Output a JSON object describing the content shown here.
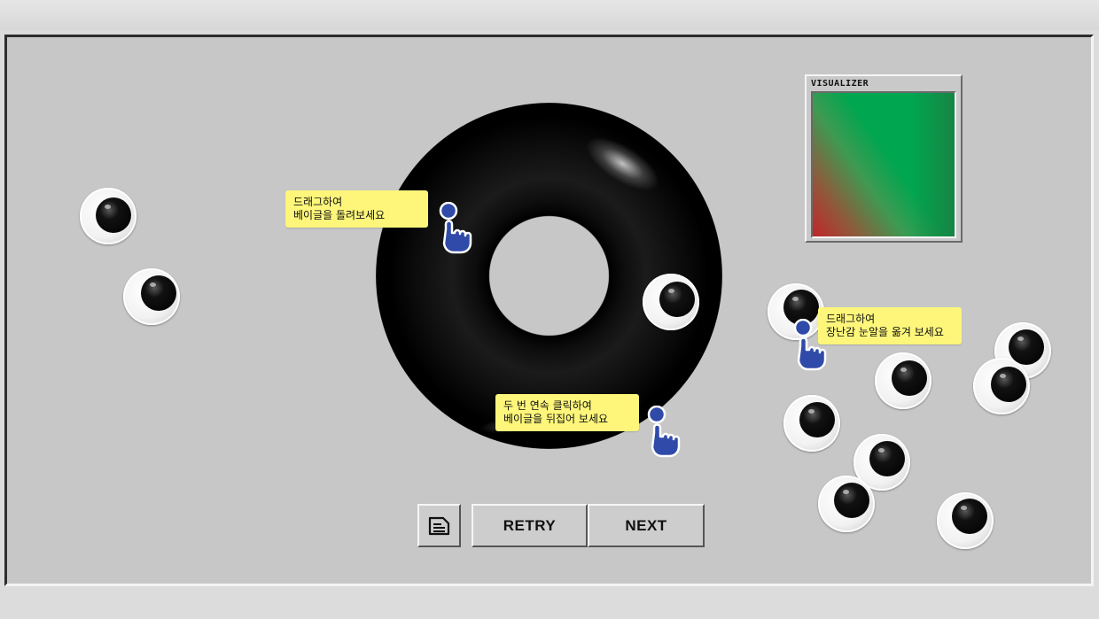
{
  "visualizer": {
    "title": "VISUALIZER"
  },
  "hints": {
    "rotate": {
      "line1": "드래그하여",
      "line2": "베이글을 돌려보세요"
    },
    "flip": {
      "line1": "두 번 연속 클릭하여",
      "line2": "베이글을 뒤집어 보세요"
    },
    "move_eyes": {
      "line1": "드래그하여",
      "line2": "장난감 눈알을 옮겨 보세요"
    }
  },
  "controls": {
    "retry_label": "RETRY",
    "next_label": "NEXT",
    "notes_icon": "document-icon"
  },
  "colors": {
    "tooltip_bg": "#fdf67a",
    "hint_blue": "#2f4aa8",
    "bagel": "#000000",
    "panel": "#c7c7c7"
  },
  "icons": {
    "hand": "pointing-hand-icon",
    "eye": "googly-eye-icon"
  }
}
